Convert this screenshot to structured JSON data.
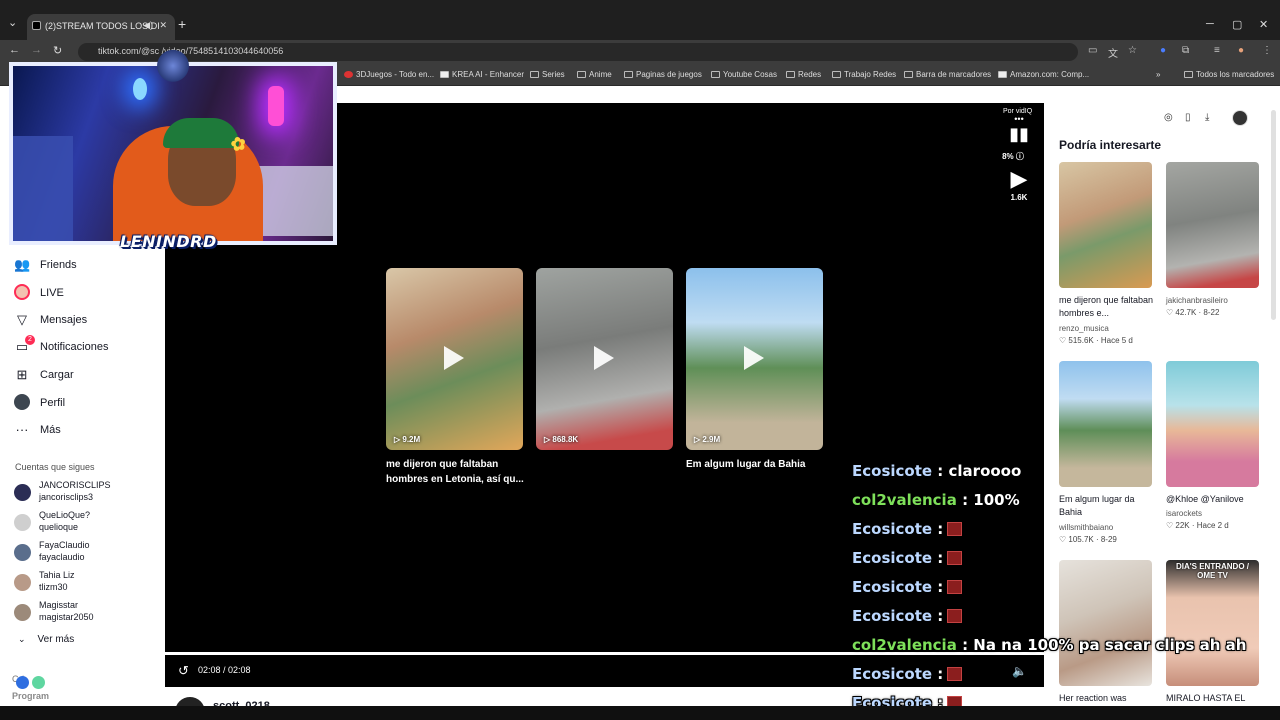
{
  "browser": {
    "tab_title": "(2)STREAM TODOS LOS DI",
    "url": "tiktok.com/@sc        /video/7548514103044640056",
    "bookmarks": [
      "3DJuegos - Todo en...",
      "KREA AI - Enhancer",
      "Series",
      "Anime",
      "Paginas de juegos",
      "Youtube Cosas",
      "Redes",
      "Trabajo Redes",
      "Barra de marcadores",
      "Amazon.com: Comp...",
      "Todos los marcadores"
    ]
  },
  "overlay": {
    "streamer_name": "LENINDRD"
  },
  "sidebar": {
    "items": [
      {
        "label": "Friends",
        "icon": "friends-icon"
      },
      {
        "label": "LIVE",
        "icon": "live-icon"
      },
      {
        "label": "Mensajes",
        "icon": "messages-icon"
      },
      {
        "label": "Notificaciones",
        "icon": "notifications-icon",
        "badge": "2"
      },
      {
        "label": "Cargar",
        "icon": "upload-icon"
      },
      {
        "label": "Perfil",
        "icon": "profile-icon"
      },
      {
        "label": "Más",
        "icon": "more-icon"
      }
    ],
    "following_header": "Cuentas que sigues",
    "following": [
      {
        "name": "JANCORISCLIPS",
        "user": "jancorisclips3"
      },
      {
        "name": "QueLioQue?",
        "user": "quelioque"
      },
      {
        "name": "FayaClaudio",
        "user": "fayaclaudio"
      },
      {
        "name": "Tahia Liz",
        "user": "tlizm30"
      },
      {
        "name": "Magisstar",
        "user": "magistar2050"
      }
    ],
    "see_more": "Ver más",
    "program_label": "Program",
    "program_prefix": "C           /"
  },
  "player": {
    "vidiq_label": "Por vidIQ",
    "vidiq_percent": "8%",
    "plays": "1.6K",
    "timecode": "02:08 / 02:08",
    "related": [
      {
        "views": "9.2M",
        "caption": "me dijeron que faltaban hombres en Letonia, así qu..."
      },
      {
        "views": "868.8K",
        "caption": ""
      },
      {
        "views": "2.9M",
        "caption": "Em algum lugar da Bahia"
      }
    ],
    "author": "scott_0218"
  },
  "chat": [
    {
      "user": "Ecosicote",
      "msg": ": claroooo",
      "color": "u1"
    },
    {
      "user": "col2valencia",
      "msg": ": 100%",
      "color": "u2"
    },
    {
      "user": "Ecosicote",
      "msg": ":",
      "color": "u1",
      "emote": true
    },
    {
      "user": "Ecosicote",
      "msg": ":",
      "color": "u1",
      "emote": true
    },
    {
      "user": "Ecosicote",
      "msg": ":",
      "color": "u1",
      "emote": true
    },
    {
      "user": "Ecosicote",
      "msg": ":",
      "color": "u1",
      "emote": true
    },
    {
      "user": "col2valencia",
      "msg": ": Na na 100% pa sacar clips ah ah",
      "color": "u2"
    },
    {
      "user": "Ecosicote",
      "msg": ":",
      "color": "u1",
      "emote": true
    },
    {
      "user": "Ecosicote",
      "msg": ":",
      "color": "u1",
      "emote": true
    }
  ],
  "right_panel": {
    "title": "Podría interesarte",
    "cards": [
      {
        "caption": "me dijeron que faltaban hombres e...",
        "user": "renzo_musica",
        "stats": "♡ 515.6K · Hace 5 d"
      },
      {
        "caption": "",
        "user": "jakichanbrasileiro",
        "stats": "♡ 42.7K · 8-22"
      },
      {
        "caption": "Em algum lugar da Bahia",
        "user": "willsmithbaiano",
        "stats": "♡ 105.7K · 8-29"
      },
      {
        "caption": "@Khloe @Yanilove",
        "user": "isarockets",
        "stats": "♡ 22K · Hace 2 d"
      },
      {
        "caption": "Her reaction was",
        "user": "",
        "stats": ""
      },
      {
        "caption": "MIRALO HASTA EL",
        "user": "",
        "stats": "",
        "overlay_text": "DIA'S ENTRANDO / OME TV"
      }
    ]
  },
  "colors": {
    "tiktok_red": "#fe2c55",
    "chat_green": "#7ee05a",
    "chat_blue": "#bcd8ff"
  }
}
